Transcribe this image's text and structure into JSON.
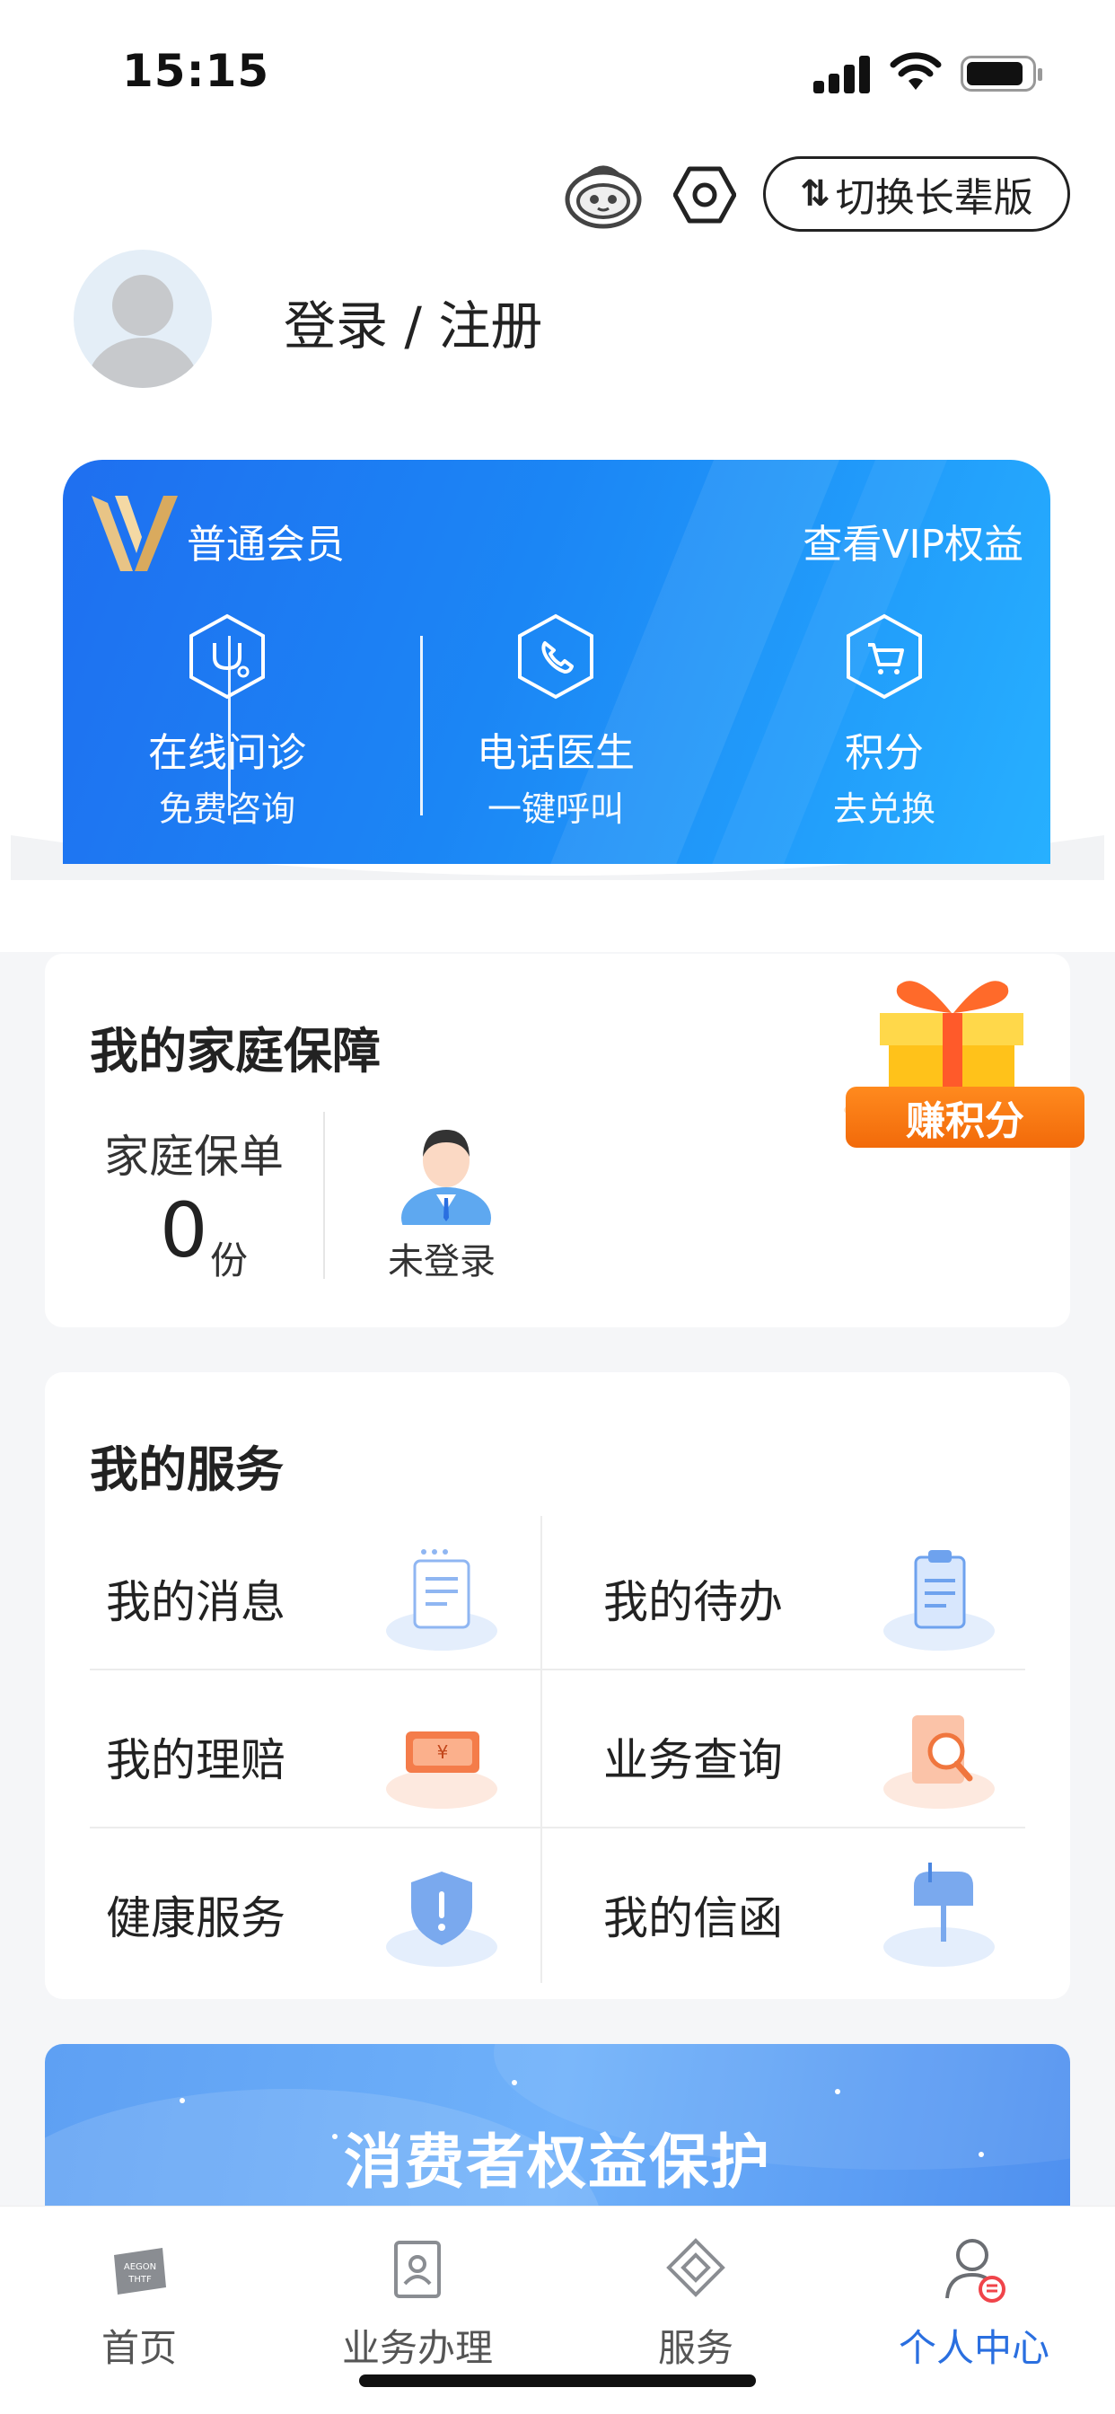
{
  "status_bar": {
    "time": "15:15"
  },
  "header": {
    "elder_mode_label": "切换长辈版",
    "elder_mode_icon": "swap-arrows-icon"
  },
  "user": {
    "login_label": "登录 / 注册"
  },
  "vip": {
    "level": "普通会员",
    "link": "查看VIP权益",
    "items": [
      {
        "title": "在线问诊",
        "sub": "免费咨询",
        "icon": "stethoscope-icon"
      },
      {
        "title": "电话医生",
        "sub": "一键呼叫",
        "icon": "phone-icon"
      },
      {
        "title": "积分",
        "sub": "去兑换",
        "icon": "cart-icon"
      }
    ]
  },
  "family": {
    "title": "我的家庭保障",
    "policy_label": "家庭保单",
    "policy_count": "0",
    "policy_unit": "份",
    "member_label": "未登录",
    "gift_label": "赚积分"
  },
  "services": {
    "title": "我的服务",
    "items": [
      {
        "label": "我的消息",
        "icon": "message-doc-icon"
      },
      {
        "label": "我的待办",
        "icon": "clipboard-icon"
      },
      {
        "label": "我的理赔",
        "icon": "claim-ticket-icon"
      },
      {
        "label": "业务查询",
        "icon": "search-doc-icon"
      },
      {
        "label": "健康服务",
        "icon": "shield-icon"
      },
      {
        "label": "我的信函",
        "icon": "mailbox-icon"
      }
    ]
  },
  "banner": {
    "text": "消费者权益保护"
  },
  "tabs": [
    {
      "label": "首页",
      "icon": "home-logo-icon"
    },
    {
      "label": "业务办理",
      "icon": "business-icon"
    },
    {
      "label": "服务",
      "icon": "service-icon"
    },
    {
      "label": "个人中心",
      "icon": "person-icon",
      "active": true
    }
  ],
  "colors": {
    "accent": "#2a6fe0",
    "vip_gradient_start": "#1f6ff0",
    "vip_gradient_end": "#27b0ff",
    "gift_orange": "#f26a0a"
  }
}
